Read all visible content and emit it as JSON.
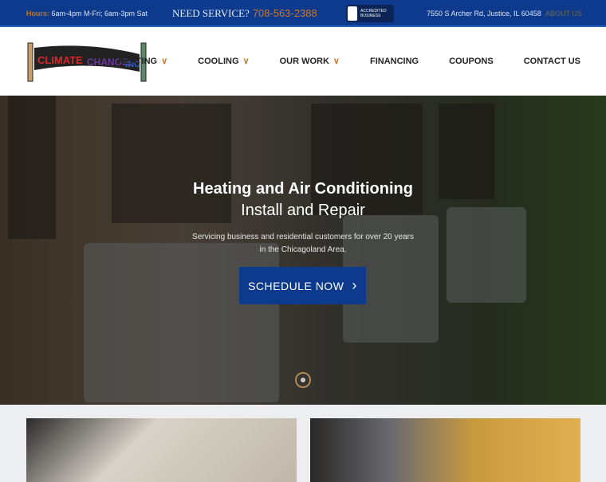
{
  "topbar": {
    "hours_label": "Hours:",
    "hours": "6am-4pm M-Fri; 6am-3pm Sat",
    "need_service": "NEED SERVICE?",
    "phone": "708-563-2388",
    "bbb": "ACCREDITED BUSINESS",
    "address": "7550 S Archer Rd, Justice, IL 60458",
    "about": "ABOUT US"
  },
  "logo": {
    "text": "CLIMATE CHANGE, INC."
  },
  "nav": [
    {
      "label": "HEATING",
      "dropdown": true
    },
    {
      "label": "COOLING",
      "dropdown": true
    },
    {
      "label": "OUR WORK",
      "dropdown": true
    },
    {
      "label": "FINANCING"
    },
    {
      "label": "COUPONS"
    },
    {
      "label": "CONTACT US"
    }
  ],
  "hero": {
    "title": "Heating and Air Conditioning",
    "subtitle": "Install and Repair",
    "desc1": "Servicing business and residential customers for over 20 years",
    "desc2": "in the Chicagoland Area.",
    "button": "SCHEDULE NOW"
  },
  "colors": {
    "brand": "#0d3a8c",
    "accent": "#c9792c"
  }
}
